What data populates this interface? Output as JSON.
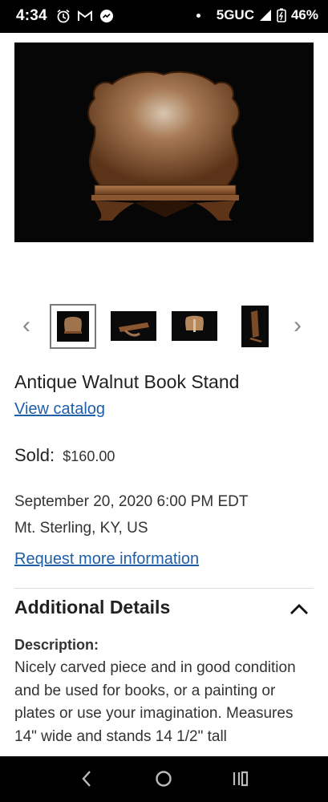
{
  "status_bar": {
    "time": "4:34",
    "left_icons": [
      "alarm-icon",
      "gmail-icon",
      "messenger-icon"
    ],
    "network": "5GUC",
    "battery": "46%"
  },
  "gallery": {
    "main_image": "antique walnut book stand photo",
    "thumbnail_count": 4,
    "selected_index": 0
  },
  "item": {
    "title": "Antique Walnut Book Stand",
    "view_catalog": "View catalog",
    "sold_label": "Sold:",
    "sold_price": "$160.00",
    "date": "September 20, 2020 6:00 PM EDT",
    "location": "Mt. Sterling, KY, US",
    "request_info": "Request more information"
  },
  "details": {
    "heading": "Additional Details",
    "description_label": "Description:",
    "description_text": "Nicely carved piece and in good condition and be used for books, or a painting or plates or use your imagination. Measures 14\" wide and stands 14 1/2\" tall"
  },
  "colors": {
    "link": "#1f5ea8",
    "text": "#222222",
    "bars": "#000000"
  }
}
